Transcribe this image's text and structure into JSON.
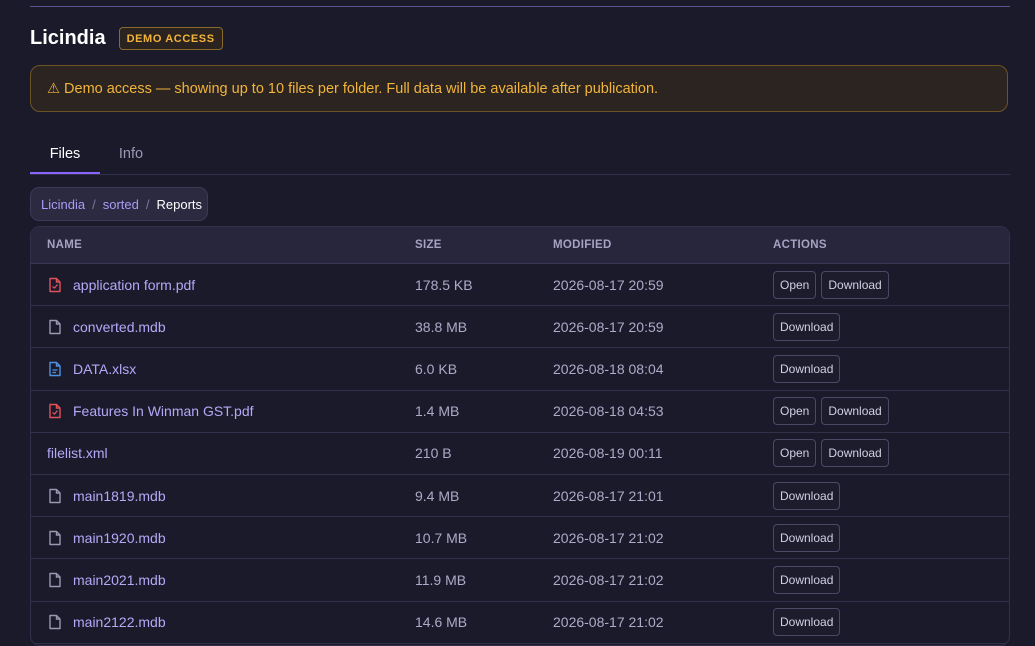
{
  "header": {
    "title": "Licindia",
    "badge": "DEMO ACCESS"
  },
  "alert": {
    "icon": "warning-icon",
    "text": "⚠ Demo access — showing up to 10 files per folder. Full data will be available after publication."
  },
  "tabs": [
    {
      "label": "Files",
      "active": true
    },
    {
      "label": "Info",
      "active": false
    }
  ],
  "breadcrumb": [
    "Licindia",
    "sorted",
    "Reports"
  ],
  "breadcrumb_sep": "/",
  "table": {
    "headers": {
      "name": "NAME",
      "size": "SIZE",
      "modified": "MODIFIED",
      "actions": "ACTIONS"
    },
    "rows": [
      {
        "name": "application form.pdf",
        "icon": "pdf-icon",
        "size": "178.5 KB",
        "modified": "2026-08-17 20:59",
        "open": "Open",
        "download": "Download"
      },
      {
        "name": "converted.mdb",
        "icon": "file-icon",
        "size": "38.8 MB",
        "modified": "2026-08-17 20:59",
        "download": "Download"
      },
      {
        "name": "DATA.xlsx",
        "icon": "spreadsheet-icon",
        "size": "6.0 KB",
        "modified": "2026-08-18 08:04",
        "download": "Download"
      },
      {
        "name": "Features In Winman GST.pdf",
        "icon": "pdf-icon",
        "size": "1.4 MB",
        "modified": "2026-08-18 04:53",
        "open": "Open",
        "download": "Download"
      },
      {
        "name": "filelist.xml",
        "icon": "",
        "size": "210 B",
        "modified": "2026-08-19 00:11",
        "open": "Open",
        "download": "Download"
      },
      {
        "name": "main1819.mdb",
        "icon": "file-icon",
        "size": "9.4 MB",
        "modified": "2026-08-17 21:01",
        "download": "Download"
      },
      {
        "name": "main1920.mdb",
        "icon": "file-icon",
        "size": "10.7 MB",
        "modified": "2026-08-17 21:02",
        "download": "Download"
      },
      {
        "name": "main2021.mdb",
        "icon": "file-icon",
        "size": "11.9 MB",
        "modified": "2026-08-17 21:02",
        "download": "Download"
      },
      {
        "name": "main2122.mdb",
        "icon": "file-icon",
        "size": "14.6 MB",
        "modified": "2026-08-17 21:02",
        "download": "Download"
      }
    ]
  },
  "colors": {
    "accent": "#8b63ff",
    "warning": "#f2b43a",
    "pdf": "#e0525a",
    "xlsx": "#4f8fe0",
    "file": "#9a97b0"
  }
}
